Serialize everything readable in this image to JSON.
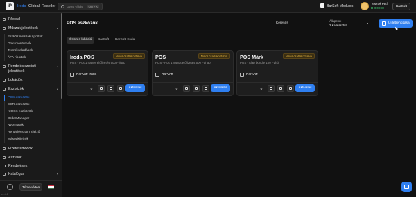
{
  "topbar": {
    "logo": "iP",
    "contexts": [
      {
        "label": "Iroda",
        "active": true
      },
      {
        "label": "Global",
        "active": false
      },
      {
        "label": "Reseller",
        "active": false
      }
    ],
    "search_placeholder": "Gyors váltás",
    "search_shortcut": "Ctrl + K",
    "modules_label": "BarSoft Modulok",
    "user_name": "Teszteł Petí",
    "user_time": "0:09:30",
    "company_button": "BarSoft"
  },
  "sidebar": {
    "items": [
      {
        "label": "Főoldal",
        "chevron": ""
      },
      {
        "label": "Műszak jelentések",
        "chevron": "▴"
      }
    ],
    "report_subitems": [
      "Eszköz műszak riportok",
      "Dokumentumok",
      "Termék eladások",
      "ÁFA riportok"
    ],
    "items2": [
      {
        "label": "Rendelés szerinti jelentések",
        "chevron": "▾"
      },
      {
        "label": "Lokációk",
        "chevron": ""
      },
      {
        "label": "Eszközök",
        "chevron": "▴"
      }
    ],
    "device_subitems": [
      {
        "label": "POS eszközök",
        "active": true
      },
      {
        "label": "ECR eszközök",
        "active": false
      },
      {
        "label": "KIOSK eszközök",
        "active": false
      },
      {
        "label": "OrderManager",
        "active": false
      },
      {
        "label": "Nyomtatók",
        "active": false
      },
      {
        "label": "Rendelésszám kijelző",
        "active": false
      },
      {
        "label": "Másodkijelzők",
        "active": false
      }
    ],
    "items3": [
      {
        "label": "Fizetési módok",
        "chevron": ""
      },
      {
        "label": "Asztalok",
        "chevron": ""
      },
      {
        "label": "Rendelések",
        "chevron": ""
      },
      {
        "label": "Katalógus",
        "chevron": "▾"
      }
    ],
    "theme_button": "Téma váltás",
    "version": "v1.4.0"
  },
  "main": {
    "title": "POS eszközök",
    "search_label": "Keresés",
    "filter_label": "Állapotok",
    "filter_value": "2 Kiválasztva",
    "new_button": "Új létrehozása",
    "tabs": [
      {
        "label": "Összes lokáció",
        "active": true
      },
      {
        "label": "BarSoft",
        "active": false
      },
      {
        "label": "BarSoft Iroda",
        "active": false
      }
    ],
    "cards": [
      {
        "title": "Iroda POS",
        "badge": "Nincs csatlakoztatva",
        "subtitle": "POS - Pos 1 napos előfizetés 500 Ft/nap",
        "business": "BarSoft Iroda",
        "count": "0",
        "action": "Aktiválás"
      },
      {
        "title": "POS",
        "badge": "Nincs csatlakoztatva",
        "subtitle": "POS - Pos 1 napos előfizetés 500 Ft/nap",
        "business": "BarSoft",
        "count": "0",
        "action": "Aktiválás"
      },
      {
        "title": "POS Márk",
        "badge": "Nincs csatlakoztatva",
        "subtitle": "POS - Alap bundle 100 Ft/hó",
        "business": "BarSoft",
        "count": "0",
        "action": "Aktiválás"
      }
    ]
  },
  "colors": {
    "accent": "#2f7ff0",
    "warning": "#e3b241",
    "background": "#111111"
  }
}
